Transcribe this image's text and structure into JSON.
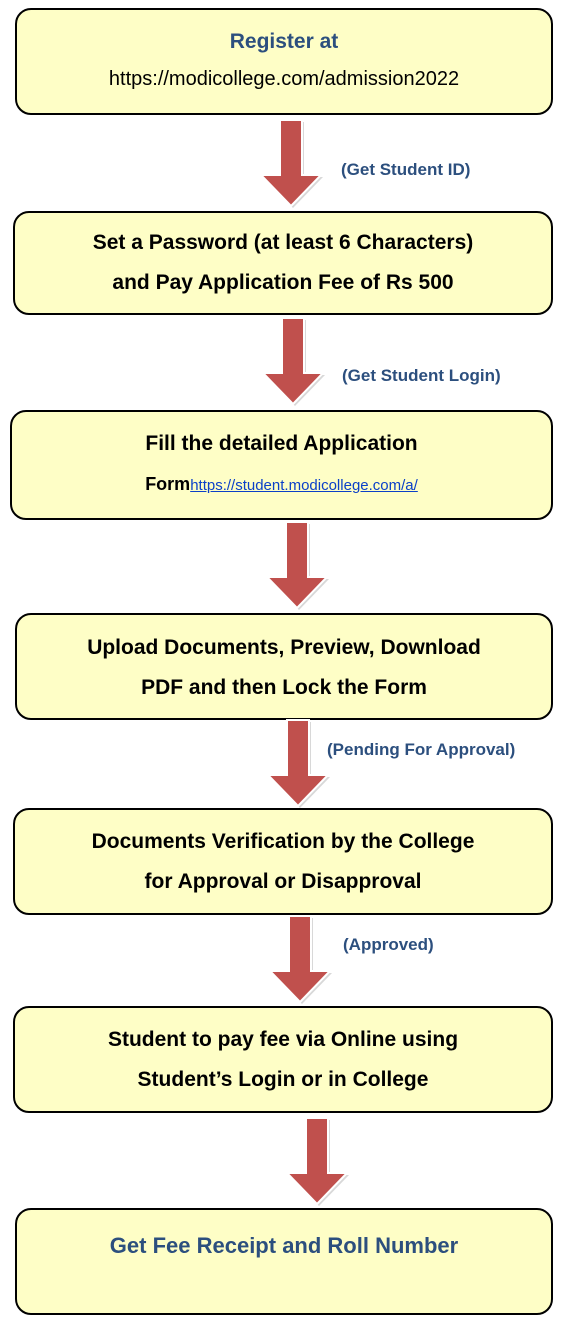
{
  "steps": [
    {
      "title": "Register at",
      "url": "https://modicollege.com/admission2022"
    },
    {
      "line1": "Set a Password (at least 6 Characters)",
      "line2": "and Pay Application Fee of Rs 500"
    },
    {
      "line1": "Fill the detailed Application",
      "line2_bold": "Form",
      "line2_link": "https://student.modicollege.com/a/"
    },
    {
      "line1": "Upload Documents, Preview, Download",
      "line2": "PDF and then Lock the Form"
    },
    {
      "line1": "Documents Verification by the College",
      "line2": "for Approval or Disapproval"
    },
    {
      "line1": "Student to pay fee via Online using",
      "line2": "Student’s Login or in College"
    },
    {
      "line1": "Get Fee Receipt and Roll Number"
    }
  ],
  "arrow_labels": [
    "(Get Student ID)",
    "(Get Student Login)",
    "(Pending For Approval)",
    "(Approved)"
  ],
  "colors": {
    "box_fill": "#fefec6",
    "arrow_fill": "#c0504d",
    "label_text": "#2c4f7e",
    "link": "#0b40c8"
  }
}
